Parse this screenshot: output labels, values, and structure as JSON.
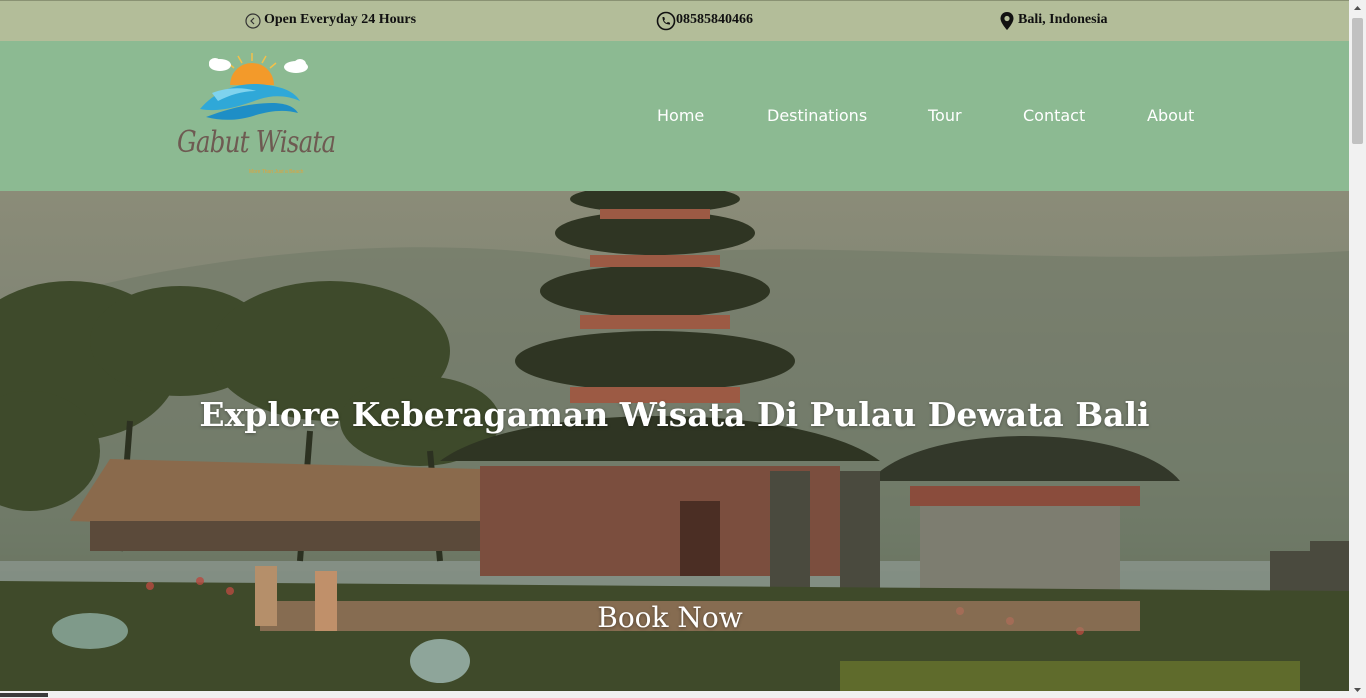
{
  "topbar": {
    "hours": "Open Everyday 24 Hours",
    "phone": "08585840466",
    "location": "Bali, Indonesia",
    "hours_icon": "clock-icon",
    "phone_icon": "phone-icon",
    "location_icon": "map-pin-icon"
  },
  "brand": {
    "name": "Gabut Wisata",
    "tagline": "More Than Just a Beach"
  },
  "nav": {
    "items": [
      {
        "label": "Home"
      },
      {
        "label": "Destinations"
      },
      {
        "label": "Tour"
      },
      {
        "label": "Contact"
      },
      {
        "label": "About"
      }
    ]
  },
  "hero": {
    "title": "Explore Keberagaman Wisata Di Pulau Dewata Bali",
    "cta_label": "Book Now"
  },
  "colors": {
    "topbar_bg": "#b3bd99",
    "navbar_bg": "#8cba92",
    "nav_text": "#ffffff"
  }
}
